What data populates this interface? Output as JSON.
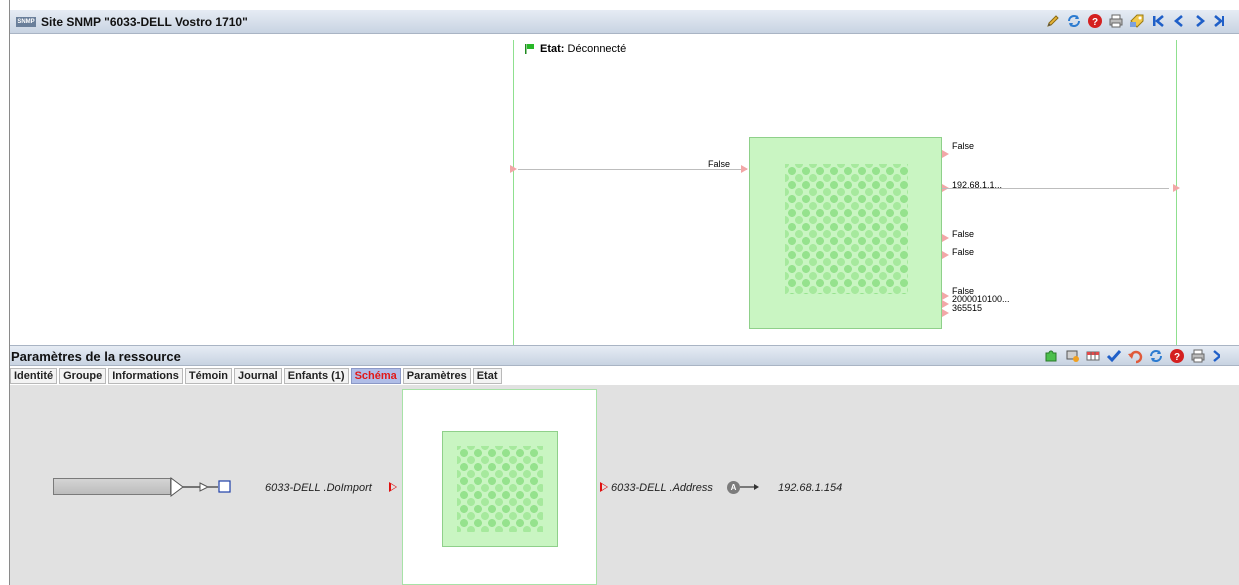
{
  "window": {
    "logo_text": "SNMP",
    "title": "Site SNMP \"6033-DELL Vostro 1710\""
  },
  "toolbar_top": {
    "icons": [
      "edit-icon",
      "refresh-icon",
      "help-icon",
      "print-icon",
      "tag-icon",
      "first-icon",
      "previous-icon",
      "next-icon",
      "last-icon"
    ]
  },
  "diagram": {
    "state_label": "Etat:",
    "state_value": "Déconnecté",
    "input_value": "False",
    "outputs": [
      "False",
      "192.68.1.1...",
      "False",
      "False",
      "False",
      "2000010100...",
      "365515"
    ]
  },
  "resource_panel": {
    "title": "Paramètres de la ressource",
    "tabs": [
      "Identité",
      "Groupe",
      "Informations",
      "Témoin",
      "Journal",
      "Enfants (1)",
      "Schéma",
      "Paramètres",
      "Etat"
    ],
    "active_tab": "Schéma"
  },
  "toolbar_bottom": {
    "icons": [
      "puzzle-icon",
      "monitor-icon",
      "table-icon",
      "check-icon",
      "undo-icon",
      "refresh-icon",
      "help-icon",
      "print-icon",
      "more-icon"
    ]
  },
  "schema": {
    "input_label": "6033-DELL .DoImport",
    "output_label": "6033-DELL .Address",
    "output_badge": "A",
    "output_value": "192.68.1.154"
  },
  "colors": {
    "titlebar": "#c8d3e2",
    "block_fill": "#c9f5c2",
    "active_tab": "#b0bde7",
    "port_arrow": "#f2a7a7",
    "signal_red": "#e01010"
  }
}
